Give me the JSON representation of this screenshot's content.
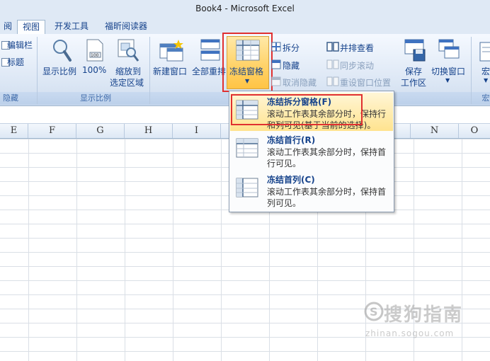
{
  "window": {
    "title": "Book4 - Microsoft Excel"
  },
  "tabs": [
    {
      "label": "阅"
    },
    {
      "label": "视图"
    },
    {
      "label": "开发工具"
    },
    {
      "label": "福昕阅读器"
    }
  ],
  "ribbon": {
    "show_group": {
      "items": [
        "编辑栏",
        "标题"
      ],
      "label": "隐藏"
    },
    "zoom_group": {
      "label": "显示比例",
      "zoom": "显示比例",
      "hundred": "100%",
      "fit_line1": "缩放到",
      "fit_line2": "选定区域"
    },
    "window_group": {
      "new_window": "新建窗口",
      "arrange_all": "全部重排",
      "freeze_panes": "冻结窗格",
      "split": "拆分",
      "hide": "隐藏",
      "unhide": "取消隐藏",
      "side_by_side": "并排查看",
      "sync_scroll": "同步滚动",
      "reset_position": "重设窗口位置",
      "save_line1": "保存",
      "save_line2": "工作区",
      "switch_window": "切换窗口",
      "macro": "宏",
      "macro_label": "宏"
    }
  },
  "columns": [
    "E",
    "F",
    "G",
    "H",
    "I",
    "N",
    "O"
  ],
  "menu": {
    "items": [
      {
        "title": "冻结拆分窗格(F)",
        "desc": "滚动工作表其余部分时，保持行和列可见(基于当前的选择)。",
        "icon": "freeze-panes-icon"
      },
      {
        "title": "冻结首行(R)",
        "desc": "滚动工作表其余部分时，保持首行可见。",
        "icon": "freeze-top-row-icon"
      },
      {
        "title": "冻结首列(C)",
        "desc": "滚动工作表其余部分时，保持首列可见。",
        "icon": "freeze-first-column-icon"
      }
    ]
  },
  "watermark": {
    "brand": "搜狗指南",
    "url": "zhinan.sogou.com"
  },
  "colors": {
    "highlight_box": "#e03030",
    "ribbon_text": "#15428b",
    "menu_hover": "#ffe38f"
  }
}
